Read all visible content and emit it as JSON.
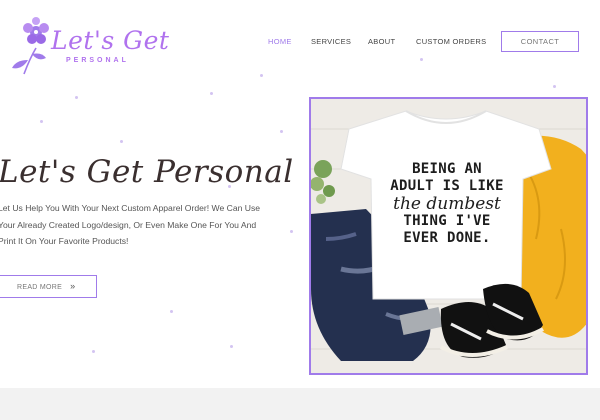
{
  "brand": {
    "logo_text": "Let's Get",
    "logo_subtext": "PERSONAL",
    "accent_color": "#a07bea"
  },
  "nav": {
    "items": [
      {
        "label": "HOME",
        "active": true
      },
      {
        "label": "SERVICES",
        "active": false
      },
      {
        "label": "ABOUT",
        "active": false
      },
      {
        "label": "CUSTOM ORDERS",
        "active": false
      }
    ],
    "contact_label": "CONTACT"
  },
  "hero": {
    "title": "Let's Get Personal",
    "lines": [
      "Let Us Help You With Your Next Custom Apparel Order! We Can Use",
      "Your Already Created Logo/design, Or Even Make One For You And",
      "Print It On Your Favorite Products!"
    ],
    "button_label": "READ MORE",
    "button_icon": "double-chevron-right-icon"
  },
  "product_image": {
    "shirt_lines": [
      "BEING AN",
      "ADULT IS LIKE",
      "the dumbest",
      "THING I'VE",
      "EVER DONE."
    ]
  }
}
